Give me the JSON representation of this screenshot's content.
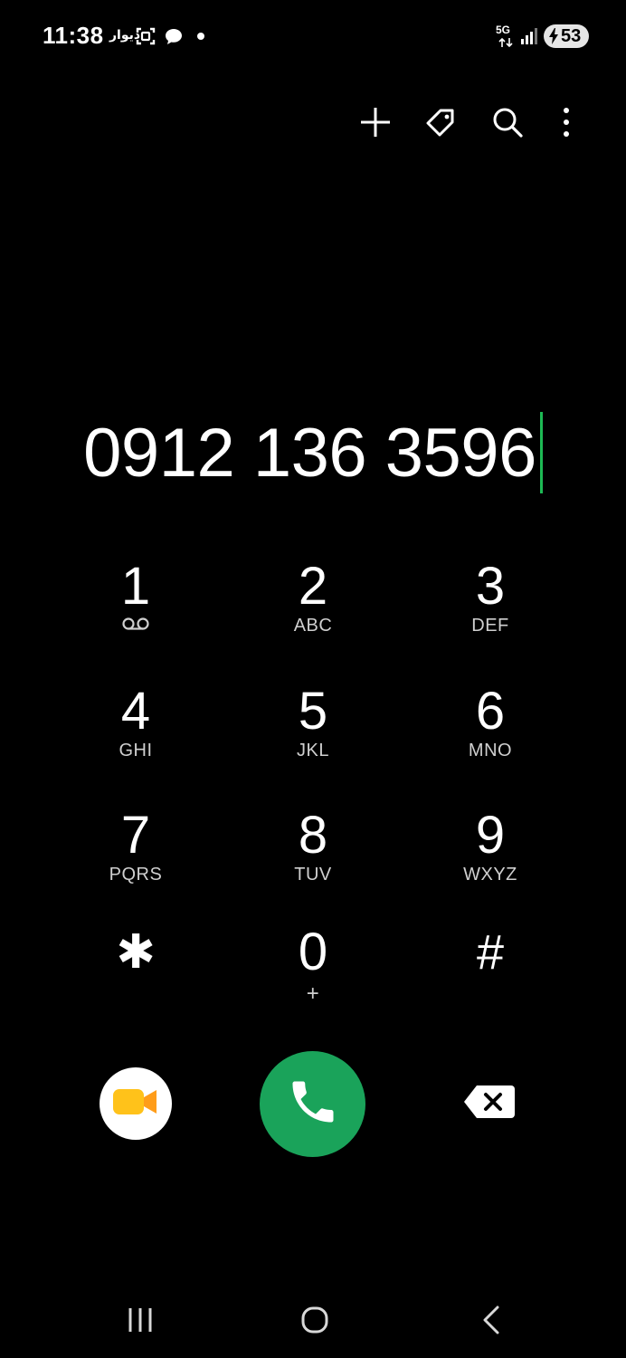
{
  "status_bar": {
    "time": "11:38",
    "app_text": "دیوار",
    "network_label": "5G",
    "battery_level": "53",
    "icons": [
      "screenshot-icon",
      "chat-bubble-icon",
      "notification-dot-icon",
      "network-5g-icon",
      "signal-icon",
      "battery-charging-icon"
    ]
  },
  "toolbar": {
    "icons": [
      "add-icon",
      "tag-icon",
      "search-icon",
      "more-options-icon"
    ]
  },
  "dialer": {
    "number": "0912 136 3596"
  },
  "keypad": {
    "keys": [
      {
        "digit": "1",
        "letters": "",
        "sub_icon": "voicemail-icon"
      },
      {
        "digit": "2",
        "letters": "ABC"
      },
      {
        "digit": "3",
        "letters": "DEF"
      },
      {
        "digit": "4",
        "letters": "GHI"
      },
      {
        "digit": "5",
        "letters": "JKL"
      },
      {
        "digit": "6",
        "letters": "MNO"
      },
      {
        "digit": "7",
        "letters": "PQRS"
      },
      {
        "digit": "8",
        "letters": "TUV"
      },
      {
        "digit": "9",
        "letters": "WXYZ"
      },
      {
        "digit": "✱",
        "letters": ""
      },
      {
        "digit": "0",
        "letters": "+"
      },
      {
        "digit": "#",
        "letters": ""
      }
    ]
  },
  "actions": {
    "video_call_icon": "video-camera-icon",
    "call_icon": "phone-icon",
    "backspace_icon": "backspace-icon"
  },
  "colors": {
    "background": "#000000",
    "call_green": "#1aa35a",
    "cursor_green": "#1db954",
    "video_icon_yellow": "#ffc21a"
  },
  "nav_bar": {
    "icons": [
      "recent-apps-icon",
      "home-icon",
      "back-icon"
    ]
  }
}
